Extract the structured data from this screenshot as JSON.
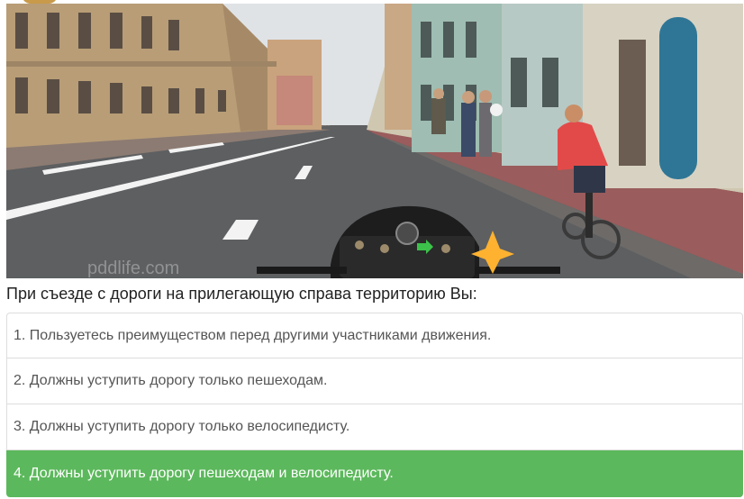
{
  "question": {
    "text": "При съезде с дороги на прилегающую справа территорию Вы:"
  },
  "answers": [
    {
      "label": "1. Пользуетесь преимуществом перед другими участниками движения.",
      "selected": false
    },
    {
      "label": "2. Должны уступить дорогу только пешеходам.",
      "selected": false
    },
    {
      "label": "3. Должны уступить дорогу только велосипедисту.",
      "selected": false
    },
    {
      "label": "4. Должны уступить дорогу пешеходам и велосипедисту.",
      "selected": true
    }
  ],
  "photo": {
    "watermark": "pddlife.com",
    "scene": "street-with-cyclist-and-pedestrians"
  },
  "colors": {
    "selected": "#5cb85c",
    "jacket": "#e24a4a",
    "sky": "#dfe3e6"
  }
}
